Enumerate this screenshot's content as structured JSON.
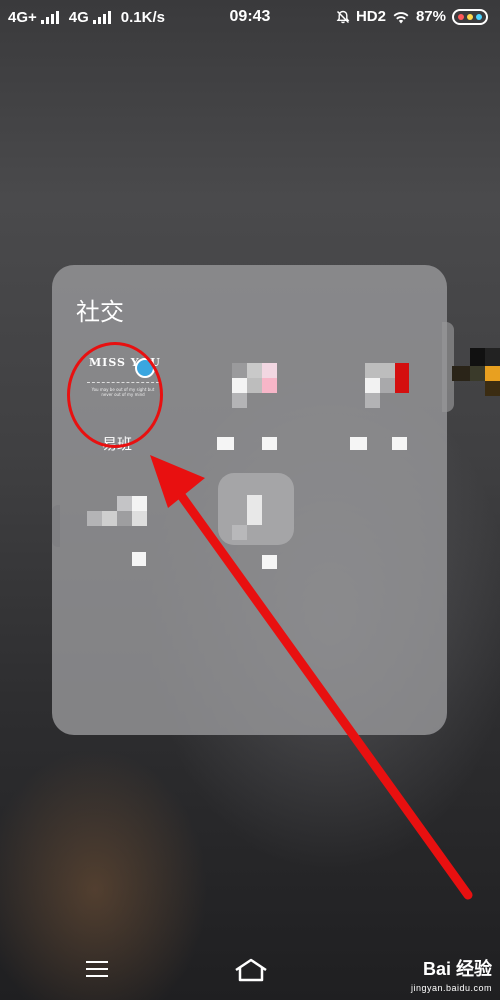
{
  "status_bar": {
    "network1": "4G+",
    "network2": "4G",
    "speed": "0.1K/s",
    "time": "09:43",
    "hd": "HD2",
    "battery": "87%",
    "dot_colors": [
      "#ff5a5a",
      "#ffd84a",
      "#4ad3ff"
    ]
  },
  "folder": {
    "title": "社交",
    "apps": [
      {
        "label": "易班",
        "icon": "yiban-miss-you-icon",
        "icon_text": "MISS YOU",
        "tagline": "You may be out of my sight but never out of my mind"
      },
      {
        "label": "",
        "icon": "pixelated-app-icon"
      },
      {
        "label": "",
        "icon": "pixelated-app-icon"
      },
      {
        "label": "",
        "icon": "pixelated-app-icon"
      },
      {
        "label": "",
        "icon": "pixelated-app-icon"
      }
    ]
  },
  "annotation": {
    "color": "#e81010"
  },
  "nav_bar": {
    "menu_icon": "menu-icon",
    "home_icon": "home-icon"
  },
  "watermark": {
    "text": "Bai 经验",
    "sub": "jingyan.baidu.com"
  }
}
